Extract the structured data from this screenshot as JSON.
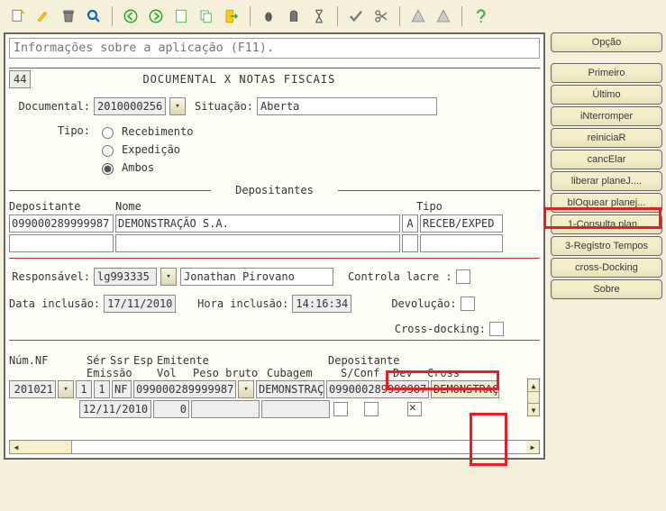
{
  "info_placeholder": "Informações sobre a aplicação (F11).",
  "page_no": "44",
  "heading": "DOCUMENTAL X NOTAS FISCAIS",
  "form": {
    "documental_lbl": "Documental:",
    "documental": "2010000256",
    "situacao_lbl": "Situação:",
    "situacao": "Aberta",
    "tipo_lbl": "Tipo:",
    "tipo_receb": "Recebimento",
    "tipo_exped": "Expedição",
    "tipo_ambos": "Ambos"
  },
  "dep": {
    "section": "Depositantes",
    "col_cod": "Depositante",
    "col_nome": "Nome",
    "col_tipo": "Tipo",
    "row": {
      "cod": "099000289999987",
      "nome": "DEMONSTRAÇÃO S.A.",
      "tipo": "A",
      "tipo_desc": "RECEB/EXPED"
    }
  },
  "resp": {
    "lbl": "Responsável:",
    "cod": "lg993335",
    "nome": "Jonathan Pirovano",
    "controla_lbl": "Controla lacre :",
    "data_lbl": "Data inclusão:",
    "data": "17/11/2010",
    "hora_lbl": "Hora inclusão:",
    "hora": "14:16:34",
    "devol_lbl": "Devolução:",
    "cross_lbl": "Cross-docking:"
  },
  "nf": {
    "h_num": "Núm.NF",
    "h_ser": "Sér",
    "h_ssr": "Ssr",
    "h_esp": "Esp",
    "h_emit": "Emitente",
    "h_dep": "Depositante",
    "h_emis": "Emissão",
    "h_vol": "Vol",
    "h_peso": "Peso bruto",
    "h_cub": "Cubagem",
    "h_sconf": "S/Conf",
    "h_dev": "Dev",
    "h_cross": "Cross",
    "row": {
      "num": "201021",
      "ser": "1",
      "ssr": "1",
      "esp": "NF",
      "emit": "099000289999987",
      "emit_nm": "DEMONSTRAÇ",
      "dep": "099000289999987",
      "dep_nm": "DEMONSTRAÇ",
      "emis": "12/11/2010",
      "vol": "0"
    }
  },
  "side": {
    "title": "Opção",
    "btns": [
      "Primeiro",
      "Último",
      "iNterromper",
      "reiniciaR",
      "cancElar",
      "liberar planeJ....",
      "blOquear planej...",
      "1-Consulta plan...",
      "3-Registro Tempos",
      "cross-Docking",
      "Sobre"
    ]
  },
  "icons": [
    "new",
    "edit",
    "delete",
    "search",
    "prev",
    "next",
    "doc",
    "copy",
    "exit",
    "bug",
    "info",
    "timer",
    "check",
    "scissors",
    "warn",
    "warn2",
    "help"
  ]
}
